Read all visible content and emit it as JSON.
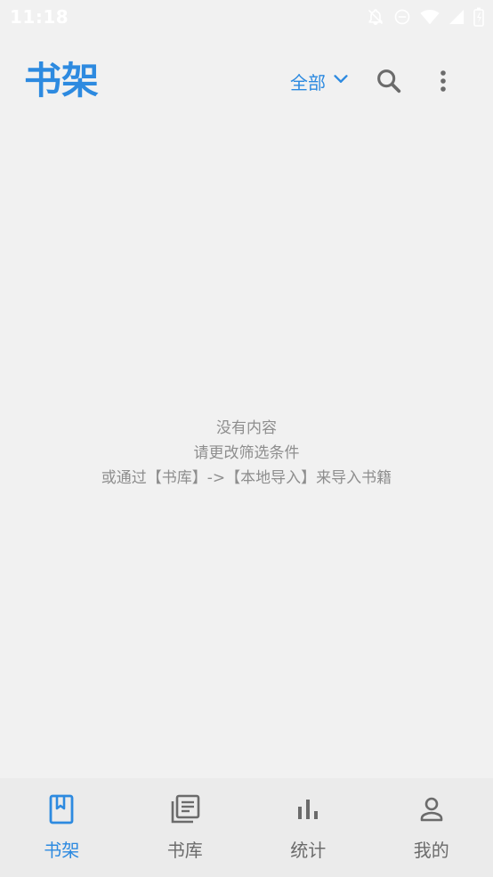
{
  "status_bar": {
    "time": "11:18",
    "icons": [
      "notifications-off-icon",
      "do-not-disturb-icon",
      "wifi-icon",
      "signal-icon",
      "battery-icon"
    ]
  },
  "header": {
    "title": "书架",
    "filter_label": "全部",
    "filter_icon": "chevron-down-icon",
    "search_icon": "search-icon",
    "more_icon": "more-vert-icon"
  },
  "empty_state": {
    "line1": "没有内容",
    "line2": "请更改筛选条件",
    "line3": "或通过【书库】->【本地导入】来导入书籍"
  },
  "bottom_nav": {
    "items": [
      {
        "label": "书架",
        "icon": "bookmark-book-icon",
        "active": true
      },
      {
        "label": "书库",
        "icon": "library-icon",
        "active": false
      },
      {
        "label": "统计",
        "icon": "bar-chart-icon",
        "active": false
      },
      {
        "label": "我的",
        "icon": "person-icon",
        "active": false
      }
    ]
  },
  "colors": {
    "accent": "#2d8ae0",
    "background": "#f1f1f1",
    "nav_background": "#ebebeb",
    "muted_text": "#8e8e8e",
    "icon_gray": "#6b6b6b"
  }
}
